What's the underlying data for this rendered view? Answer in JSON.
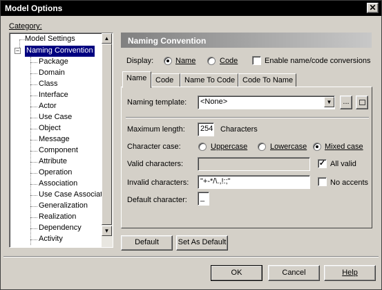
{
  "window": {
    "title": "Model Options",
    "close_glyph": "✕"
  },
  "category_label": "Category:",
  "tree": {
    "root": "Model Settings",
    "selected": "Naming Convention",
    "expand_glyph": "−",
    "children": [
      "Package",
      "Domain",
      "Class",
      "Interface",
      "Actor",
      "Use Case",
      "Object",
      "Message",
      "Component",
      "Attribute",
      "Operation",
      "Association",
      "Use Case Associat",
      "Generalization",
      "Realization",
      "Dependency",
      "Activity"
    ]
  },
  "panel": {
    "header": "Naming Convention"
  },
  "display": {
    "label": "Display:",
    "name_option": "Name",
    "code_option": "Code",
    "selected": "Name",
    "enable_label": "Enable name/code conversions",
    "enable_checked": false
  },
  "tabs": [
    "Name",
    "Code",
    "Name To Code",
    "Code To Name"
  ],
  "active_tab": "Name",
  "form": {
    "template_label": "Naming template:",
    "template_value": "<None>",
    "browse_label": "...",
    "max_length_label": "Maximum length:",
    "max_length_value": "254",
    "characters_label": "Characters",
    "case_label": "Character case:",
    "uppercase": "Uppercase",
    "lowercase": "Lowercase",
    "mixed_case": "Mixed case",
    "case_selected": "Mixed case",
    "valid_label": "Valid characters:",
    "valid_value": "",
    "all_valid_label": "All valid",
    "all_valid_checked": true,
    "invalid_label": "Invalid characters:",
    "invalid_value": "\"+-*/\\.,!:;\"",
    "no_accents_label": "No accents",
    "no_accents_checked": false,
    "default_char_label": "Default character:",
    "default_char_value": "_"
  },
  "buttons": {
    "default": "Default",
    "set_as_default": "Set As Default",
    "ok": "OK",
    "cancel": "Cancel",
    "help": "Help"
  },
  "colors": {
    "header_gradient_start": "#808080",
    "header_gradient_end": "#c0c0c0",
    "selection": "#000080"
  }
}
